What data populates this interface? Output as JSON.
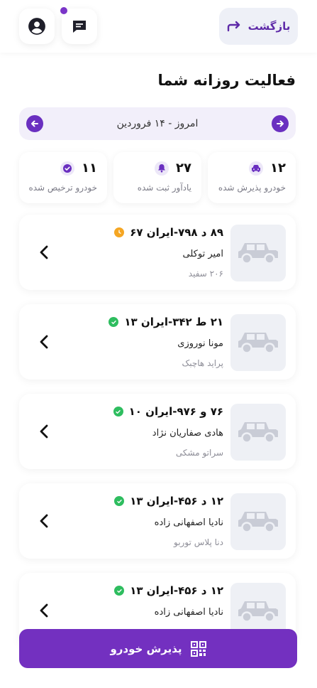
{
  "header": {
    "back_label": "بازگشت",
    "profile_icon": "account-circle-icon",
    "chat_icon": "chat-message-icon",
    "chat_has_notification": true
  },
  "page_title": "فعالیت روزانه شما",
  "date_bar": {
    "text": "امروز - ۱۴ فروردین"
  },
  "stats": [
    {
      "value": "۱۲",
      "label": "خودرو پذیرش شده",
      "icon": "car-icon"
    },
    {
      "value": "۲۷",
      "label": "یادآور ثبت شده",
      "icon": "bell-icon"
    },
    {
      "value": "۱۱",
      "label": "خودرو ترخیص شده",
      "icon": "check-circle-icon"
    }
  ],
  "vehicles": [
    {
      "plate": "۸۹ د ۷۹۸-ایران ۶۷",
      "owner": "امیر توکلی",
      "model": "۲۰۶ سفید",
      "status": "pending"
    },
    {
      "plate": "۲۱ ط ۳۴۲-ایران ۱۳",
      "owner": "مونا نوروزی",
      "model": "پراید هاچبک",
      "status": "done"
    },
    {
      "plate": "۷۶ و ۹۷۶-ایران ۱۰",
      "owner": "هادی صفاریان نژاد",
      "model": "سراتو مشکی",
      "status": "done"
    },
    {
      "plate": "۱۲ د ۴۵۶-ایران ۱۳",
      "owner": "نادیا اصفهانی زاده",
      "model": "دنا پلاس توربو",
      "status": "done"
    },
    {
      "plate": "۱۲ د ۴۵۶-ایران ۱۳",
      "owner": "نادیا اصفهانی زاده",
      "model": "",
      "status": "done"
    }
  ],
  "accept_button": {
    "label": "پذیرش خودرو",
    "icon": "qr-code-icon"
  },
  "colors": {
    "primary": "#7330c0",
    "pending": "#f5a623",
    "done": "#2ebd5f"
  }
}
